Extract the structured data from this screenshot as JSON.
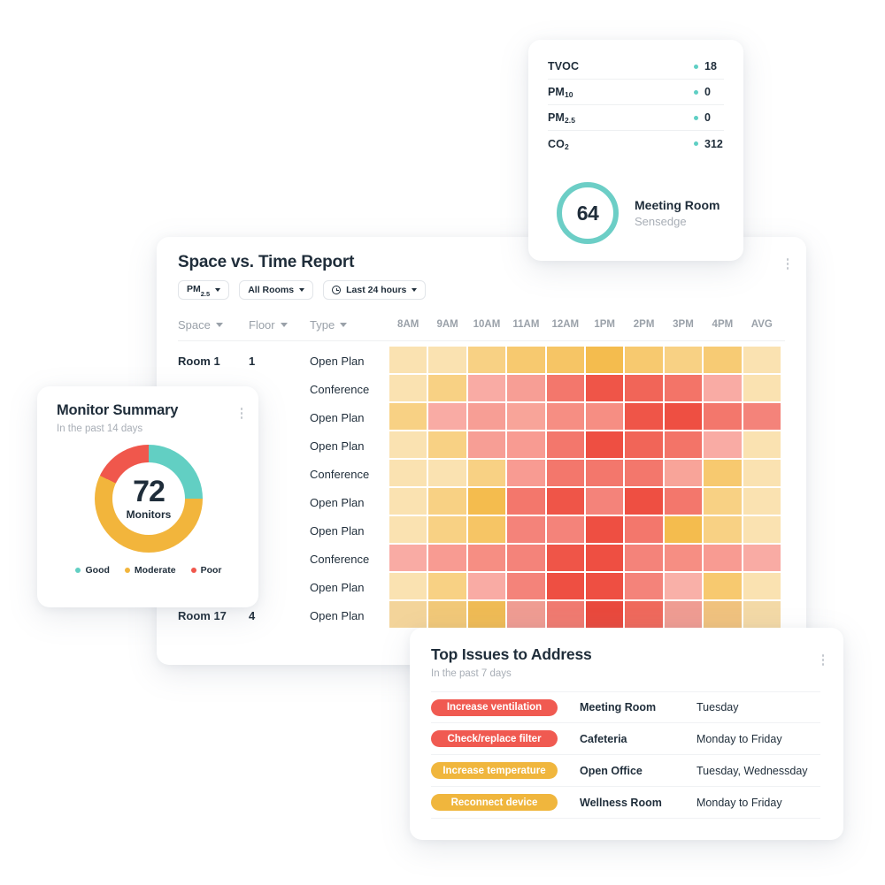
{
  "air_quality_card": {
    "metrics": [
      {
        "label": "TVOC",
        "sub": "",
        "value": "18"
      },
      {
        "label": "PM",
        "sub": "10",
        "value": "0"
      },
      {
        "label": "PM",
        "sub": "2.5",
        "value": "0"
      },
      {
        "label": "CO",
        "sub": "2",
        "value": "312"
      }
    ],
    "gauge_value": "64",
    "room_name": "Meeting Room",
    "device_name": "Sensedge",
    "dot_color": "#5fcfc4",
    "gauge_color": "#6ccec6"
  },
  "space_time_card": {
    "title": "Space vs. Time Report",
    "filters": [
      {
        "label": "PM",
        "sub": "2.5",
        "icon": "",
        "caret": true
      },
      {
        "label": "All Rooms",
        "sub": "",
        "icon": "",
        "caret": true
      },
      {
        "label": "Last 24 hours",
        "sub": "",
        "icon": "clock-icon",
        "caret": true
      }
    ],
    "column_headers": [
      "Space",
      "Floor",
      "Type"
    ],
    "time_headers": [
      "8AM",
      "9AM",
      "10AM",
      "11AM",
      "12AM",
      "1PM",
      "2PM",
      "3PM",
      "4PM",
      "AVG"
    ],
    "rows": [
      {
        "space": "Room 1",
        "floor": "1",
        "type": "Open Plan",
        "colors": [
          "#fae2b1",
          "#fae2b1",
          "#f8d184",
          "#f7c96f",
          "#f6c565",
          "#f4bc4e",
          "#f7c96f",
          "#f8d184",
          "#f7cb74",
          "#fae2b1"
        ]
      },
      {
        "space": "",
        "floor": "",
        "type": "Conference",
        "colors": [
          "#fae2b1",
          "#f8d184",
          "#f9aba4",
          "#f79e95",
          "#f3776c",
          "#ef5548",
          "#f16558",
          "#f37468",
          "#f9aba4",
          "#fae2b1"
        ]
      },
      {
        "space": "",
        "floor": "",
        "type": "Open Plan",
        "colors": [
          "#f8d184",
          "#f9aba4",
          "#f79e95",
          "#f8a499",
          "#f68e83",
          "#f68e83",
          "#ef5548",
          "#ee4f42",
          "#f3776c",
          "#f4837a"
        ]
      },
      {
        "space": "",
        "floor": "",
        "type": "Open Plan",
        "colors": [
          "#fae2b1",
          "#f8d184",
          "#f79e95",
          "#f89b92",
          "#f3776c",
          "#ee4f42",
          "#f16558",
          "#f37468",
          "#f9aba4",
          "#fae2b1"
        ]
      },
      {
        "space": "",
        "floor": "",
        "type": "Conference",
        "colors": [
          "#fae2b1",
          "#fae2b1",
          "#f8d184",
          "#f89b92",
          "#f3776c",
          "#f3776c",
          "#f3776c",
          "#f8a499",
          "#f7c96f",
          "#fae2b1"
        ]
      },
      {
        "space": "",
        "floor": "",
        "type": "Open Plan",
        "colors": [
          "#fae2b1",
          "#f8d184",
          "#f4bc4e",
          "#f3776c",
          "#ef5548",
          "#f4837a",
          "#ee4f42",
          "#f3776c",
          "#f8d184",
          "#fae2b1"
        ]
      },
      {
        "space": "",
        "floor": "",
        "type": "Open Plan",
        "colors": [
          "#fae2b1",
          "#f8d184",
          "#f6c565",
          "#f4837a",
          "#f4837a",
          "#ee4f42",
          "#f3776c",
          "#f4bc4e",
          "#f8d184",
          "#fae2b1"
        ]
      },
      {
        "space": "",
        "floor": "",
        "type": "Conference",
        "colors": [
          "#f9aba4",
          "#f89b92",
          "#f68e83",
          "#f4837a",
          "#ef5548",
          "#ee4f42",
          "#f4837a",
          "#f68e83",
          "#f89b92",
          "#f9aba4"
        ]
      },
      {
        "space": "",
        "floor": "",
        "type": "Open Plan",
        "colors": [
          "#fae2b1",
          "#f8d184",
          "#f9aba4",
          "#f4837a",
          "#ee4f42",
          "#ee4f42",
          "#f4837a",
          "#f9b0a8",
          "#f7c96f",
          "#fae2b1"
        ]
      },
      {
        "space": "Room 17",
        "floor": "4",
        "type": "Open Plan",
        "colors": [
          "#f3d49a",
          "#f1c878",
          "#efbb55",
          "#ef9c92",
          "#f07a70",
          "#e9493d",
          "#ef695c",
          "#ef9c92",
          "#f0c27e",
          "#f3d9a6"
        ]
      }
    ]
  },
  "monitor_summary_card": {
    "title": "Monitor Summary",
    "subtitle": "In the past 14 days",
    "center_value": "72",
    "center_label": "Monitors",
    "segments": [
      {
        "label": "Good",
        "color": "#62cfc3",
        "percent": 25
      },
      {
        "label": "Moderate",
        "color": "#f2b53c",
        "percent": 57
      },
      {
        "label": "Poor",
        "color": "#f0574c",
        "percent": 18
      }
    ]
  },
  "top_issues_card": {
    "title": "Top Issues to Address",
    "subtitle": "In the past 7 days",
    "issues": [
      {
        "action": "Increase ventilation",
        "color": "#f05a51",
        "room": "Meeting Room",
        "days": "Tuesday"
      },
      {
        "action": "Check/replace filter",
        "color": "#f05a51",
        "room": "Cafeteria",
        "days": "Monday to Friday"
      },
      {
        "action": "Increase temperature",
        "color": "#f0b63d",
        "room": "Open Office",
        "days": "Tuesday, Wednessday"
      },
      {
        "action": "Reconnect device",
        "color": "#f0b63d",
        "room": "Wellness Room",
        "days": "Monday to Friday"
      }
    ]
  }
}
